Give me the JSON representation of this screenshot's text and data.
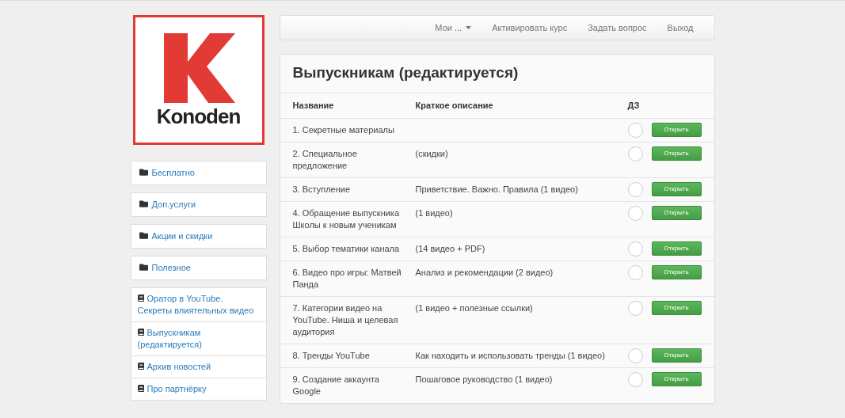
{
  "logo": {
    "text": "Konoden"
  },
  "sidebar": {
    "groups": [
      {
        "items": [
          {
            "label": "Бесплатно"
          }
        ]
      },
      {
        "items": [
          {
            "label": "Доп.услуги"
          }
        ]
      },
      {
        "items": [
          {
            "label": "Акции и скидки"
          }
        ]
      },
      {
        "items": [
          {
            "label": "Полезное"
          }
        ]
      },
      {
        "items": [
          {
            "label": "Оратор в YouTube. Секреты влиятельных видео"
          },
          {
            "label": "Выпускникам (редактируется)"
          },
          {
            "label": "Архив новостей"
          },
          {
            "label": "Про партнёрку"
          }
        ]
      }
    ]
  },
  "nav": {
    "items": [
      {
        "label": "Мои ...",
        "dropdown": true
      },
      {
        "label": "Активировать курс",
        "dropdown": false
      },
      {
        "label": "Задать вопрос",
        "dropdown": false
      },
      {
        "label": "Выход",
        "dropdown": false
      }
    ]
  },
  "page_title": "Выпускникам (редактируется)",
  "table": {
    "columns": [
      "Название",
      "Краткое описание",
      "ДЗ"
    ],
    "rows": [
      {
        "name": "1. Секретные материалы",
        "description": "",
        "done": false,
        "button": "Открыть"
      },
      {
        "name": "2. Специальное предложение",
        "description": "(скидки)",
        "done": false,
        "button": "Открыть"
      },
      {
        "name": "3. Вступление",
        "description": "Приветствие. Важно. Правила (1 видео)",
        "done": false,
        "button": "Открыть"
      },
      {
        "name": "4. Обращение выпускника Школы к новым ученикам",
        "description": "(1 видео)",
        "done": false,
        "button": "Открыть"
      },
      {
        "name": "5. Выбор тематики канала",
        "description": "(14 видео + PDF)",
        "done": false,
        "button": "Открыть"
      },
      {
        "name": "6. Видео про игры: Матвей Панда",
        "description": "Анализ и рекомендации (2 видео)",
        "done": false,
        "button": "Открыть"
      },
      {
        "name": "7. Категории видео на YouTube. Ниша и целевая аудитория",
        "description": "(1 видео + полезные ссылки)",
        "done": false,
        "button": "Открыть"
      },
      {
        "name": "8. Тренды YouTube",
        "description": "Как находить и использовать тренды (1 видео)",
        "done": false,
        "button": "Открыть"
      },
      {
        "name": "9. Создание аккаунта Google",
        "description": "Пошаговое руководство (1 видео)",
        "done": false,
        "button": "Открыть"
      }
    ]
  }
}
